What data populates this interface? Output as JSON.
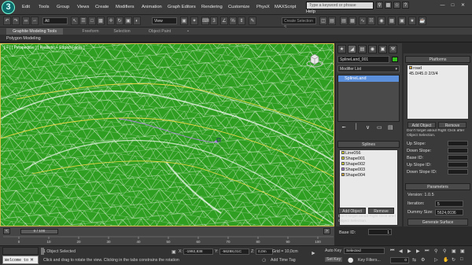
{
  "app": {
    "logo_text": "3",
    "menu": [
      "Edit",
      "Tools",
      "Group",
      "Views",
      "Create",
      "Modifiers",
      "Animation",
      "Graph Editors",
      "Rendering",
      "Customize",
      "PhysX",
      "MAXScript",
      "Help"
    ],
    "search_placeholder": "Type a keyword or phrase"
  },
  "toolbar": {
    "filter_value": "All",
    "refcoord_value": "View",
    "selection_set_placeholder": "Create Selection S"
  },
  "ribbon": {
    "tabs": [
      "Graphite Modeling Tools",
      "Freeform",
      "Selection",
      "Object Paint"
    ],
    "active_tab": 0,
    "subtab": "Polygon Modeling"
  },
  "viewport": {
    "label": "[ + ] [ Perspective ] [ Realistic + Edged Faces ]"
  },
  "command_panel": {
    "object_name": "SplineLand_001",
    "object_color": "#33c01c",
    "modifier_list_label": "Modifier List",
    "stack_items": [
      "SplineLand"
    ],
    "splines_title": "Splines",
    "splines": [
      {
        "name": "Line056",
        "swatch": "#d9d936"
      },
      {
        "name": "Shape001",
        "swatch": "#d9d936"
      },
      {
        "name": "Shape002",
        "swatch": "#d9d936"
      },
      {
        "name": "Shape003",
        "swatch": "#a07bd9"
      },
      {
        "name": "Shape004",
        "swatch": "#d9a936"
      }
    ],
    "add_object_label": "Add Object",
    "remove_label": "Remove",
    "note": "Don't forget about Right Click after Object Selection.",
    "base_id_label": "Base ID:",
    "base_id_value": "1"
  },
  "platforms_panel": {
    "title": "Platforms",
    "items": [
      "road",
      "45.0/45.0  2/3/4"
    ],
    "add_object_label": "Add Object",
    "remove_label": "Remove",
    "note": "Don't forget about Right Click after Object Selection.",
    "params": [
      "Up Slope:",
      "Down Slope:",
      "Base ID:",
      "Up Slope ID:",
      "Down Slope ID:"
    ],
    "parameters_title": "Parameters",
    "version": "Version: 1.0.5",
    "iteration_label": "Iteration:",
    "iteration_value": "5",
    "dummy_size_label": "Dummy Size:",
    "dummy_size_value": "5624,0036",
    "generate_label": "Generate Surface"
  },
  "timeline": {
    "slider_label": "0 / 100",
    "ticks": [
      "0",
      "10",
      "20",
      "30",
      "40",
      "50",
      "60",
      "70",
      "80",
      "90",
      "100"
    ]
  },
  "status": {
    "maxscript_text": "Welcome to M",
    "selected": "1 Object Selected",
    "prompt": "Click and drag to rotate the view.  Clicking in the tabs constrains the rotation",
    "x_label": "X:",
    "x_value": "-1992,838",
    "y_label": "Y:",
    "y_value": "-56288,01C",
    "z_label": "Z:",
    "z_value": "0,0m",
    "grid": "Grid = 10,0cm",
    "add_time_tag": "Add Time Tag",
    "auto_key": "Auto Key",
    "set_key": "Set Key",
    "selected_dropdown": "Selected",
    "key_filters": "Key Filters...",
    "frame_value": "0"
  }
}
